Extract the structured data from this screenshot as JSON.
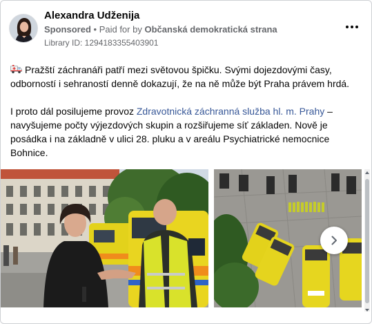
{
  "post": {
    "author": "Alexandra Udženija",
    "sponsored_label": "Sponsored",
    "separator": " • ",
    "paid_for_prefix": "Paid for by ",
    "paid_for_name": "Občanská demokratická strana",
    "library_id": "Library ID: 1294183355403901",
    "more_icon": "more-horizontal-icon",
    "paragraph1": "Pražští záchranáři patří mezi světovou špičku. Svými dojezdovými časy, odborností i sehraností denně dokazují, že na ně může být Praha právem hrdá.",
    "paragraph2_before": "I proto dál posilujeme provoz ",
    "paragraph2_link": "Zdravotnická záchranná služba hl. m. Prahy",
    "paragraph2_after": " – navyšujeme počty výjezdových skupin a rozšiřujeme síť základen. Nově je posádka i na základně v ulici 28. pluku a v areálu Psychiatrické nemocnice Bohnice.",
    "ellipsis": "...",
    "ambulance_icon": "ambulance-emoji-icon"
  },
  "carousel": {
    "image1_alt": "photo-handshake",
    "image2_alt": "photo-ambulances-aerial",
    "next_icon": "chevron-right-icon"
  },
  "colors": {
    "link": "#385898",
    "secondary_text": "#65676b",
    "ambulance_yellow": "#e3d21b",
    "ambulance_orange": "#f08c1c"
  }
}
